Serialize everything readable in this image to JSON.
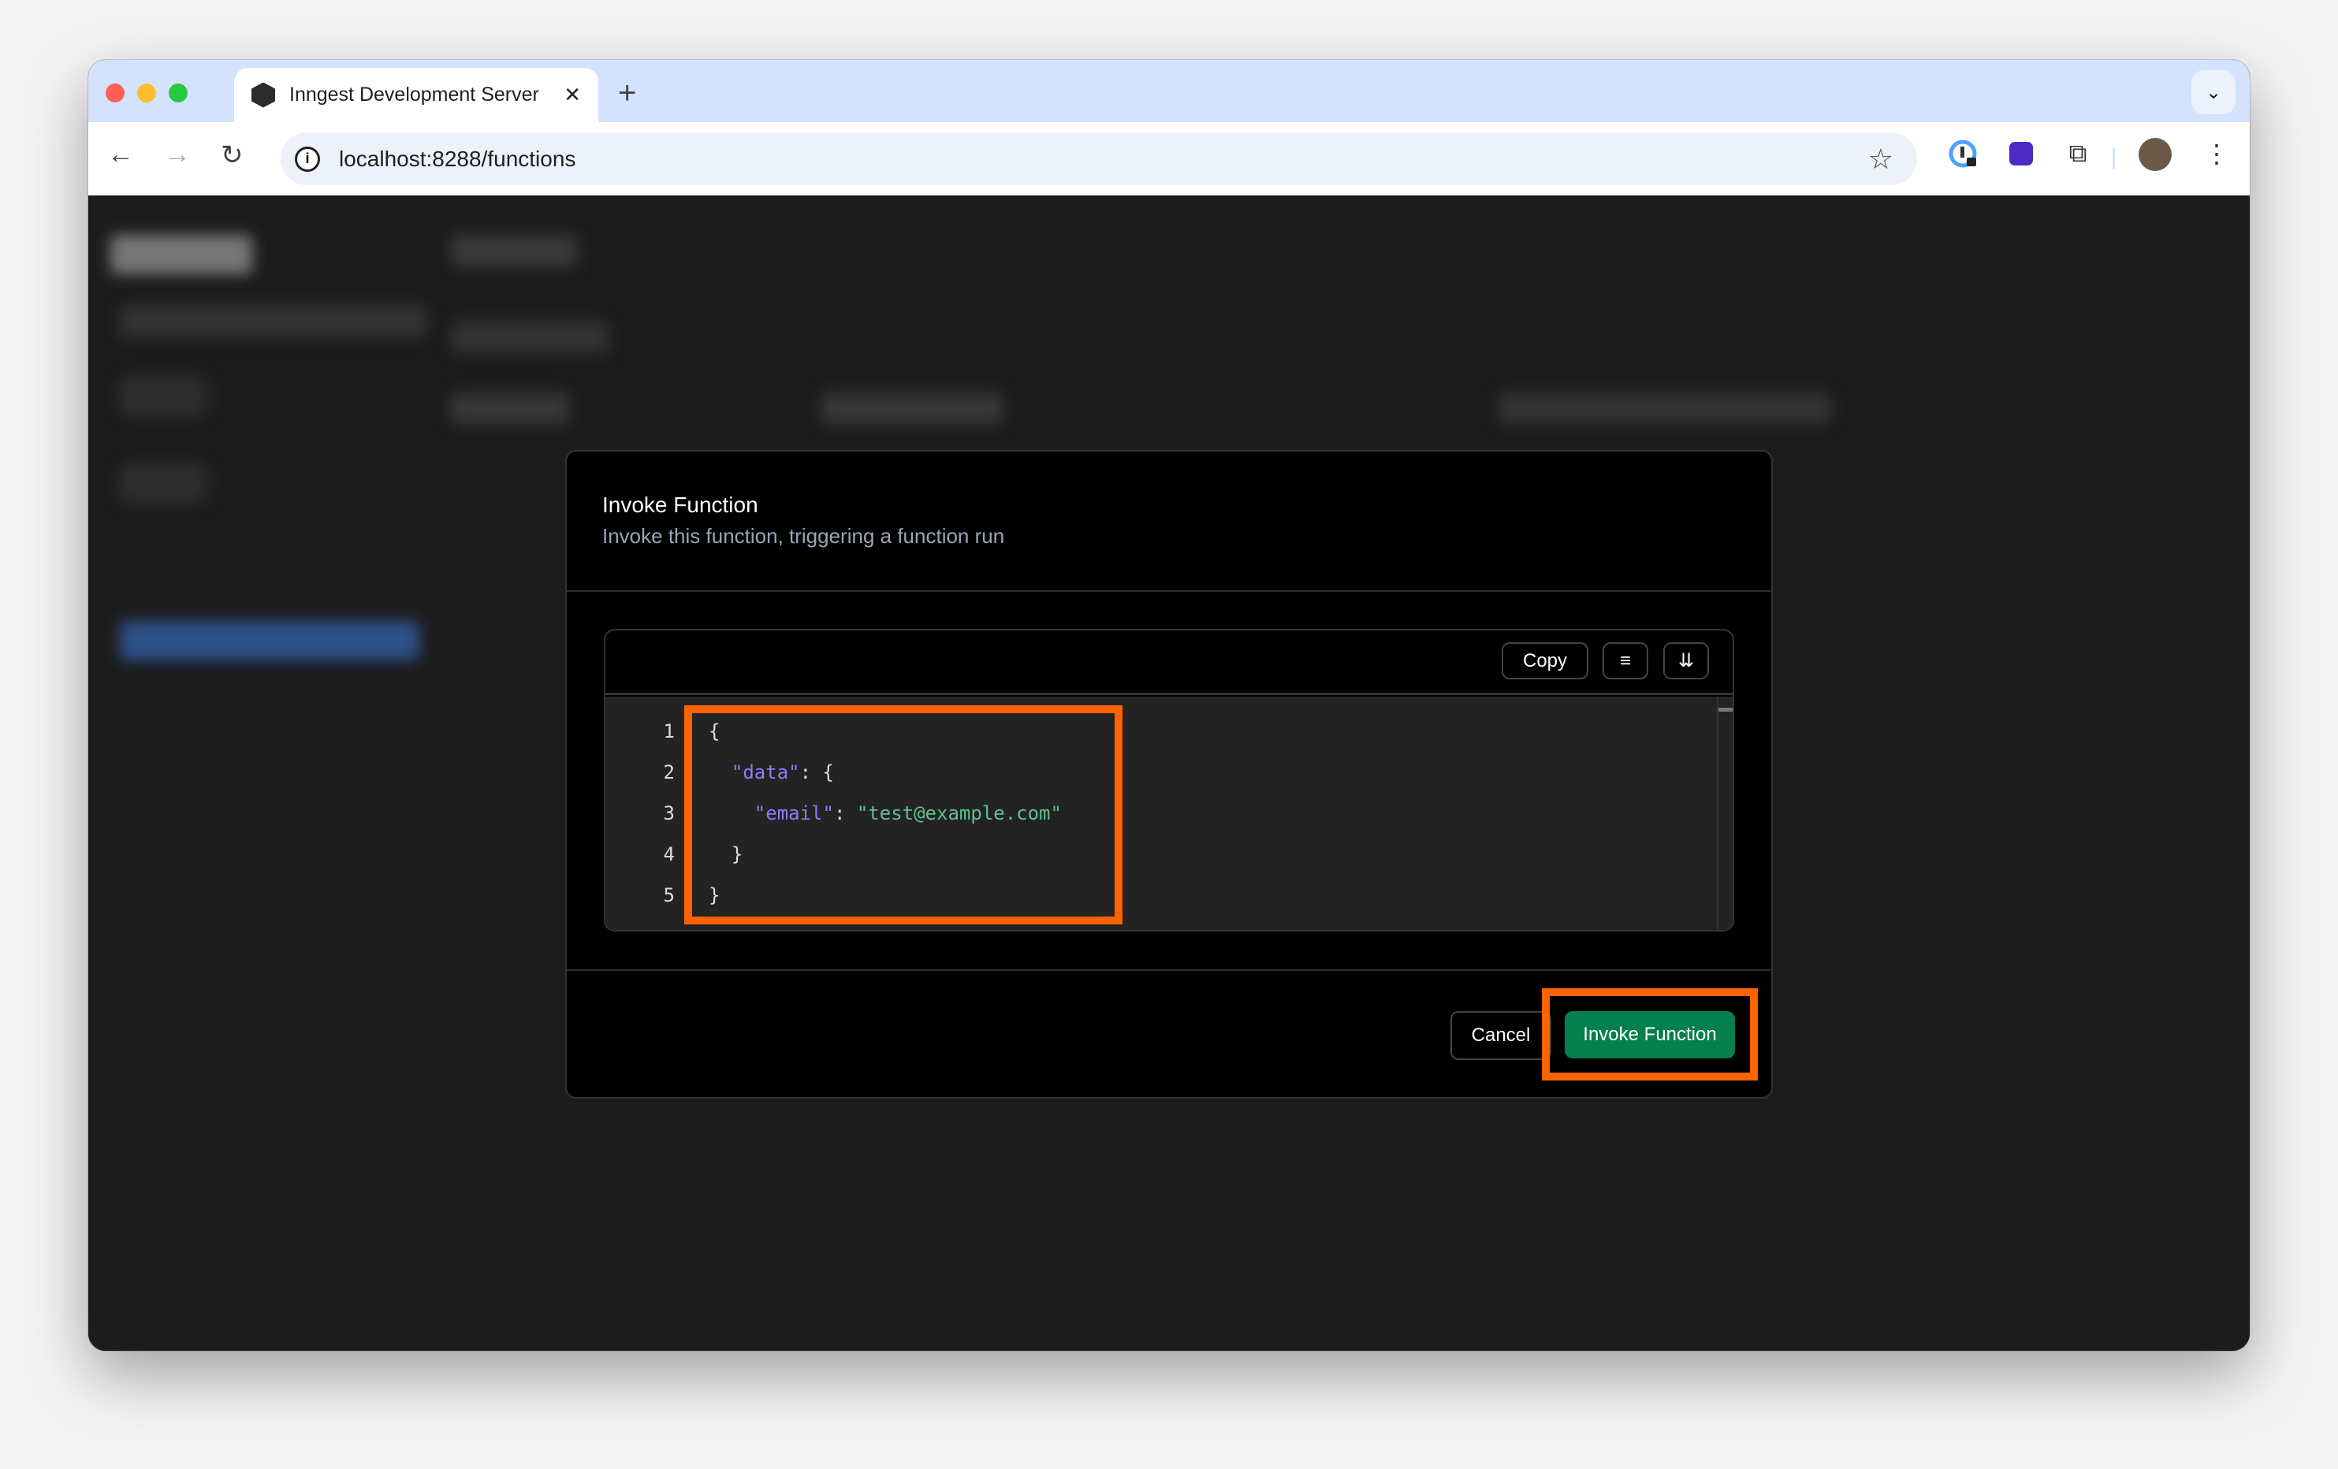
{
  "browser": {
    "tab_title": "Inngest Development Server",
    "url": "localhost:8288/functions",
    "icons": [
      "back-icon",
      "forward-icon",
      "reload-icon",
      "info-icon",
      "star-icon",
      "password-manager-icon",
      "extension-globe-icon",
      "puzzle-icon",
      "avatar",
      "kebab-menu-icon"
    ]
  },
  "modal": {
    "title": "Invoke Function",
    "subtitle": "Invoke this function, triggering a function run",
    "copy_label": "Copy",
    "code_lines": [
      {
        "n": "1",
        "indent": "",
        "parts": [
          [
            "p",
            "{"
          ]
        ]
      },
      {
        "n": "2",
        "indent": "  ",
        "parts": [
          [
            "k",
            "\"data\""
          ],
          [
            "p",
            ": {"
          ]
        ]
      },
      {
        "n": "3",
        "indent": "    ",
        "parts": [
          [
            "k",
            "\"email\""
          ],
          [
            "p",
            ": "
          ],
          [
            "s",
            "\"test@example.com\""
          ]
        ]
      },
      {
        "n": "4",
        "indent": "  ",
        "parts": [
          [
            "p",
            "}"
          ]
        ]
      },
      {
        "n": "5",
        "indent": "",
        "parts": [
          [
            "p",
            "}"
          ]
        ]
      }
    ],
    "cancel_label": "Cancel",
    "invoke_label": "Invoke Function"
  },
  "colors": {
    "accent_green": "#057f4d",
    "highlight": "#ff6200",
    "json_key": "#8b7cf5",
    "json_string": "#5fc08e"
  }
}
